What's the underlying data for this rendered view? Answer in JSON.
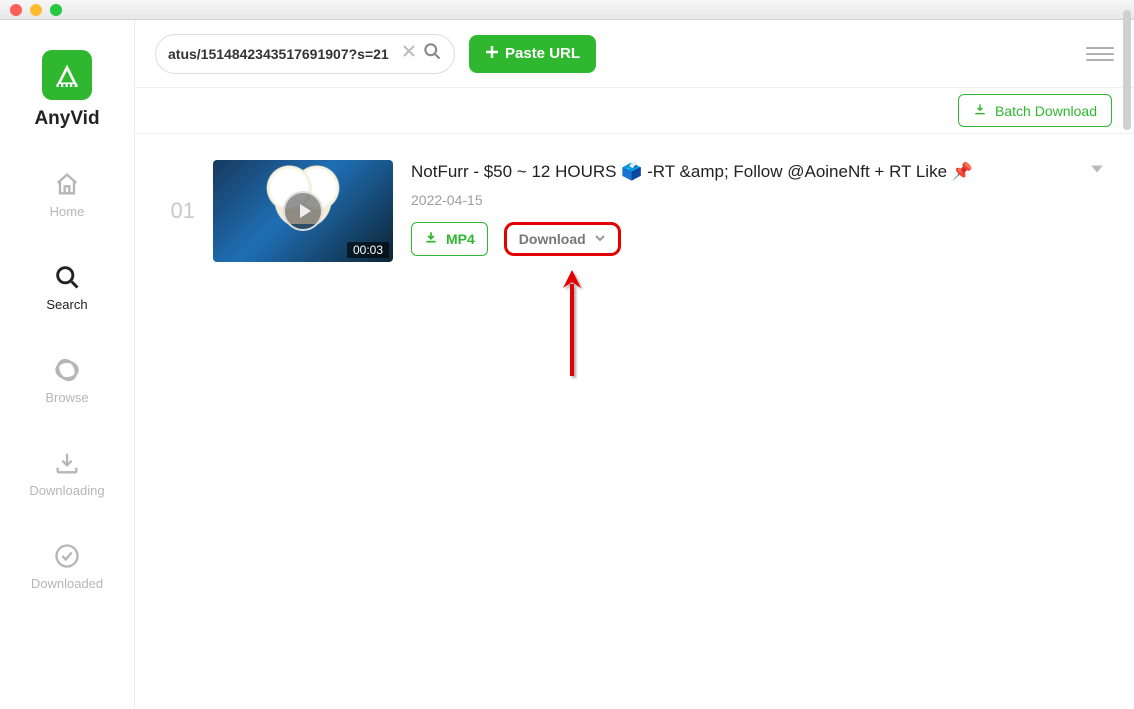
{
  "app": {
    "name": "AnyVid"
  },
  "titlebar": {},
  "toolbar": {
    "search_value": "atus/1514842343517691907?s=21",
    "paste_label": "Paste URL"
  },
  "topstrip": {
    "batch_label": "Batch Download"
  },
  "sidebar": {
    "items": [
      {
        "label": "Home",
        "icon": "home-icon",
        "active": false
      },
      {
        "label": "Search",
        "icon": "search-icon",
        "active": true
      },
      {
        "label": "Browse",
        "icon": "browse-icon",
        "active": false
      },
      {
        "label": "Downloading",
        "icon": "downloading-icon",
        "active": false
      },
      {
        "label": "Downloaded",
        "icon": "downloaded-icon",
        "active": false
      }
    ]
  },
  "results": [
    {
      "index": "01",
      "title": "NotFurr - $50 ~ 12 HOURS 🗳️ -RT &amp; Follow @AoineNft + RT Like 📌",
      "date": "2022-04-15",
      "duration": "00:03",
      "mp4_label": "MP4",
      "download_label": "Download"
    }
  ],
  "colors": {
    "accent": "#2fb82f",
    "highlight": "#e40000"
  }
}
